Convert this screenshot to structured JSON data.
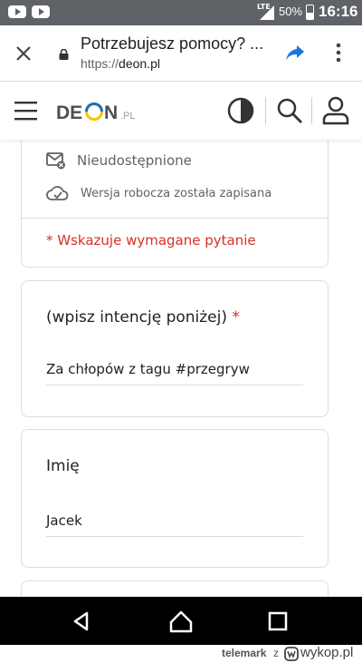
{
  "status_bar": {
    "network": "LTE",
    "battery": "50%",
    "time": "16:16"
  },
  "browser": {
    "page_title": "Potrzebujesz pomocy? ...",
    "url_scheme": "https://",
    "url_host": "deon.pl"
  },
  "site": {
    "logo_text": "DEON",
    "logo_suffix": ".PL"
  },
  "form": {
    "unshared_label": "Nieudostępnione",
    "draft_saved_label": "Wersja robocza została zapisana",
    "required_note": "* Wskazuje wymagane pytanie",
    "intention": {
      "question": "(wpisz intencję poniżej)",
      "required_mark": "*",
      "answer": "Za chłopów z tagu #przegryw"
    },
    "name": {
      "question": "Imię",
      "answer": "Jacek"
    }
  },
  "watermark": {
    "user": "telemark",
    "connector": "z",
    "site": "wykop.pl"
  },
  "colors": {
    "required": "#d93025",
    "share_blue": "#1a73e8",
    "logo_blue": "#1d6fb8",
    "logo_yellow": "#f5c400",
    "status_bar": "#5f6368"
  }
}
